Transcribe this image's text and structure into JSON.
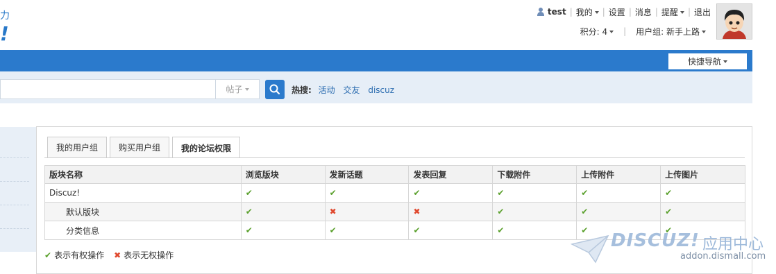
{
  "logo": {
    "frag1": "力",
    "frag2": "!"
  },
  "user_bar": {
    "username": "test",
    "items": [
      "我的",
      "设置",
      "消息",
      "提醒",
      "退出"
    ],
    "credits": "积分: 4",
    "usergroup": "用户组: 新手上路"
  },
  "nav": {
    "quick_nav": "快捷导航"
  },
  "search": {
    "input_value": "",
    "type_selected": "帖子",
    "hot_label": "热搜:",
    "hot_links": [
      "活动",
      "交友",
      "discuz"
    ]
  },
  "tabs": [
    {
      "label": "我的用户组"
    },
    {
      "label": "购买用户组"
    },
    {
      "label": "我的论坛权限"
    }
  ],
  "table": {
    "headers": [
      "版块名称",
      "浏览版块",
      "发新话题",
      "发表回复",
      "下载附件",
      "上传附件",
      "上传图片"
    ],
    "rows": [
      {
        "name": "Discuz!",
        "perms": [
          "✔",
          "✔",
          "✔",
          "✔",
          "✔",
          "✔"
        ]
      },
      {
        "name": "默认版块",
        "perms": [
          "✔",
          "✖",
          "✖",
          "✔",
          "✔",
          "✔"
        ]
      },
      {
        "name": "分类信息",
        "perms": [
          "✔",
          "✔",
          "✔",
          "✔",
          "✔",
          "✔"
        ]
      }
    ]
  },
  "legend": {
    "ok_symbol": "✔",
    "ok_text": "表示有权操作",
    "no_symbol": "✖",
    "no_text": "表示无权操作"
  },
  "watermark": {
    "brand": "DISCUZ!",
    "cn": "应用中心",
    "url": "addon.dismall.com"
  },
  "colors": {
    "accent": "#2b7acc",
    "ok": "#5aa02c",
    "no": "#e0492f"
  }
}
